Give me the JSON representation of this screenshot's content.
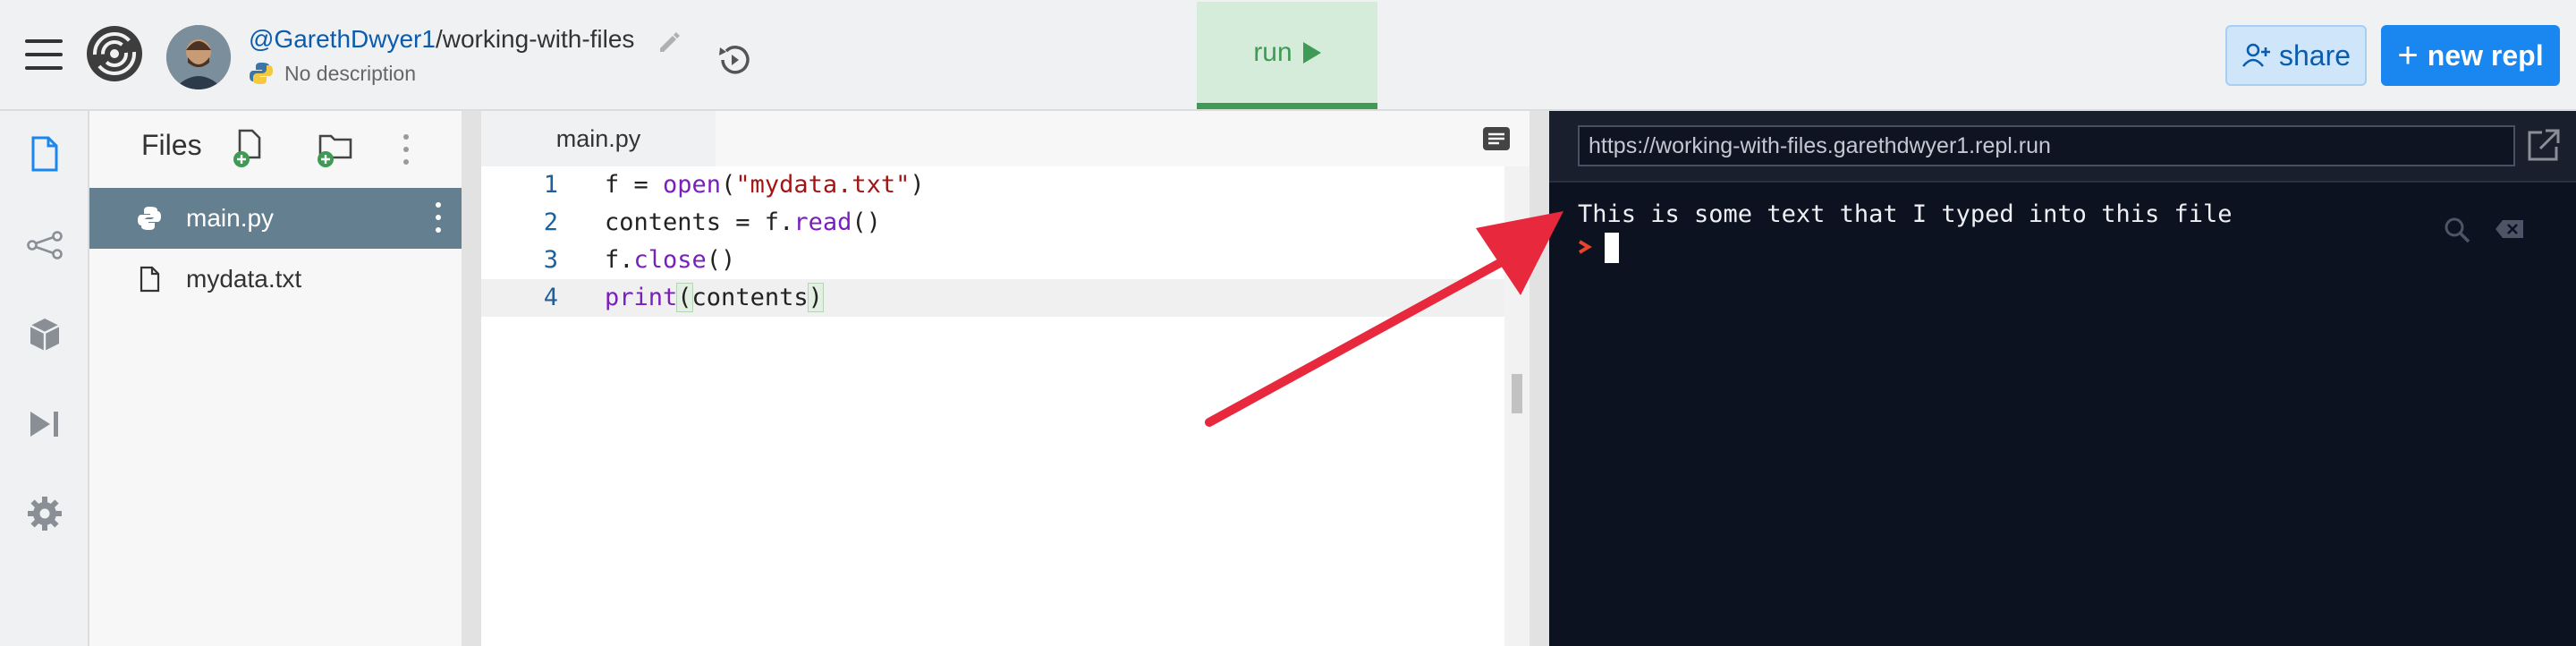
{
  "header": {
    "username": "@GarethDwyer1",
    "separator": "/",
    "repl_name": "working-with-files",
    "description": "No description",
    "run_label": "run",
    "share_label": "share",
    "new_repl_label": "new repl"
  },
  "files_panel": {
    "title": "Files",
    "items": [
      {
        "name": "main.py",
        "active": true
      },
      {
        "name": "mydata.txt",
        "active": false
      }
    ]
  },
  "editor": {
    "tab_label": "main.py",
    "line_numbers": [
      "1",
      "2",
      "3",
      "4"
    ],
    "current_line": 4
  },
  "console": {
    "url": "https://working-with-files.garethdwyer1.repl.run",
    "output": "This is some text that I typed into this file"
  },
  "colors": {
    "run_green": "#3f9a55",
    "new_repl_blue": "#1a86f0",
    "annotation_arrow": "#e8283c",
    "console_bg": "#0d1220"
  },
  "icons": [
    "menu-icon",
    "replit-logo",
    "pencil-icon",
    "python-icon",
    "history-icon",
    "play-icon",
    "user-plus-icon",
    "plus-icon",
    "files-icon",
    "share-network-icon",
    "package-icon",
    "debugger-icon",
    "settings-gear-icon",
    "new-file-icon",
    "new-folder-icon",
    "more-vertical-icon",
    "file-icon",
    "format-icon",
    "open-external-icon",
    "search-icon",
    "clear-icon",
    "prompt-chevron-icon"
  ]
}
